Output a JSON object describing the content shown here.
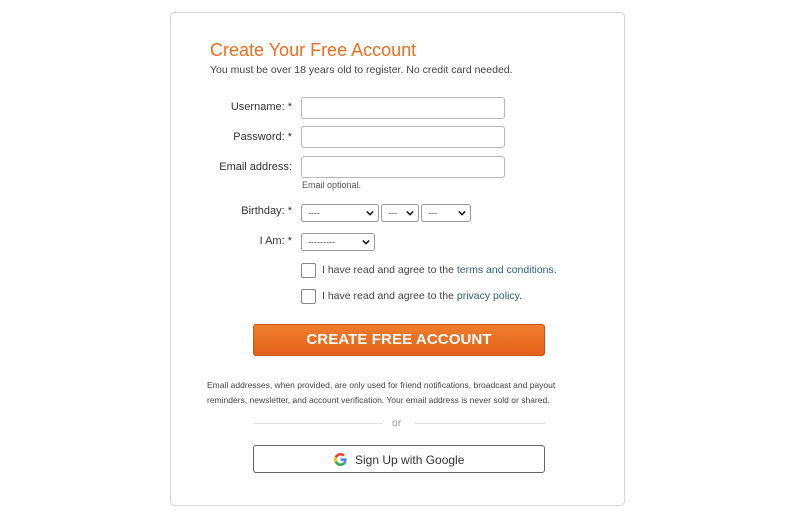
{
  "form": {
    "title": "Create Your Free Account",
    "subtitle": "You must be over 18 years old to register. No credit card needed.",
    "username_label": "Username: *",
    "username_value": "",
    "password_label": "Password: *",
    "password_value": "",
    "email_label": "Email address:",
    "email_value": "",
    "email_hint": "Email optional.",
    "birthday_label": "Birthday: *",
    "birthday_month": "----",
    "birthday_day": "---",
    "birthday_year": "---",
    "iam_label": "I Am: *",
    "iam_value": "---------",
    "terms_prefix": "I have read and agree to the ",
    "terms_link": "terms and conditions",
    "terms_suffix": ".",
    "privacy_prefix": "I have read and agree to the ",
    "privacy_link": "privacy policy",
    "privacy_suffix": ".",
    "submit_label": "CREATE FREE ACCOUNT",
    "note": "Email addresses, when provided, are only used for friend notifications, broadcast and payout reminders, newsletter, and account verification. Your email address is never sold or shared.",
    "or_label": "or",
    "google_label": "Sign Up with Google"
  },
  "colors": {
    "accent": "#ef6e1f",
    "button_top": "#f07d2c",
    "button_bottom": "#e2611b",
    "link": "#2d5f7c"
  }
}
